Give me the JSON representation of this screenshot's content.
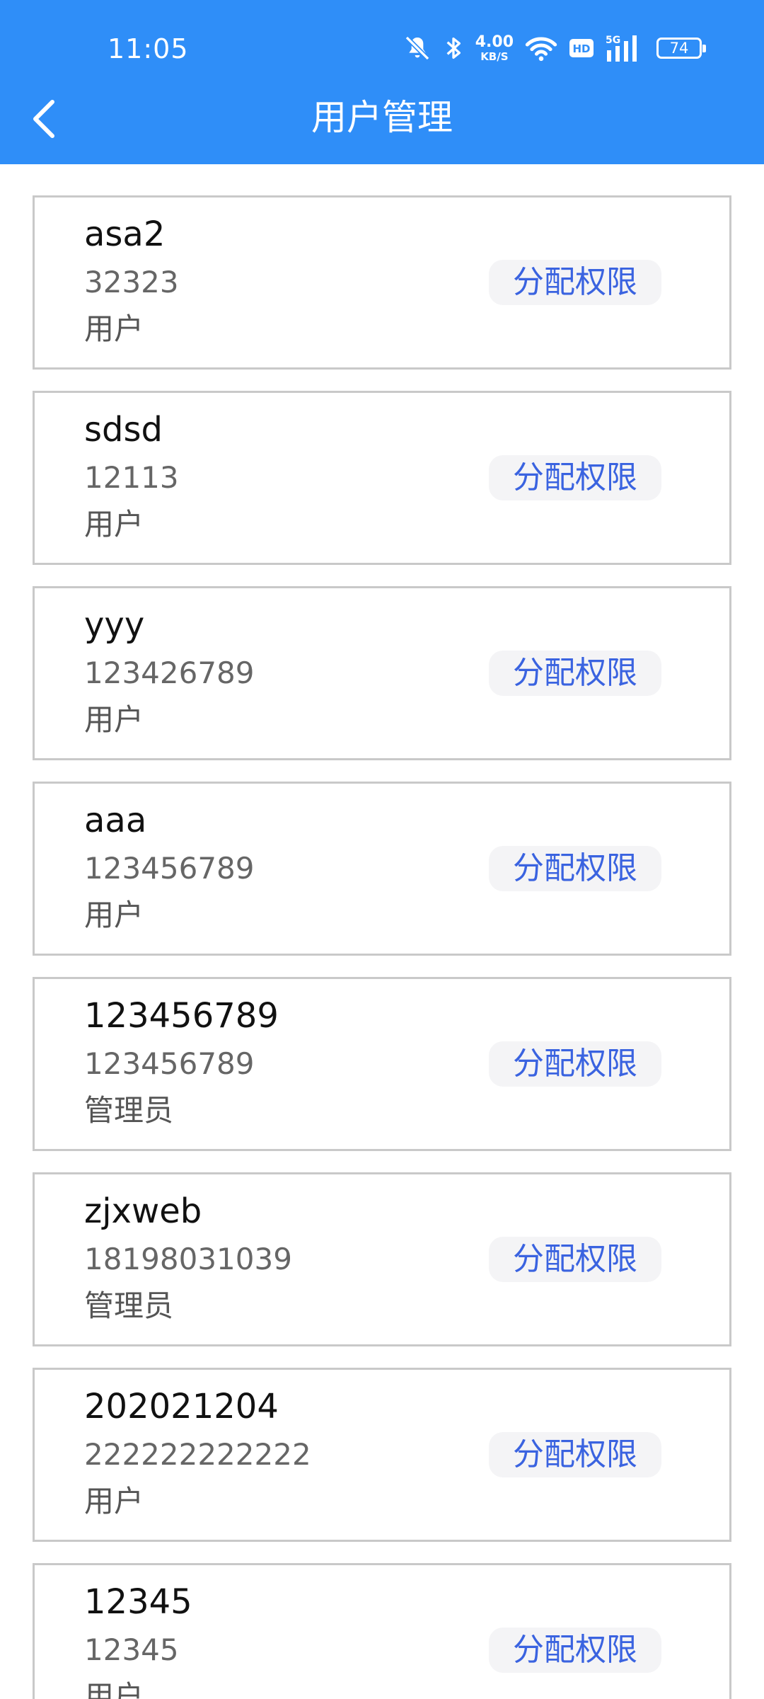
{
  "status_bar": {
    "time": "11:05",
    "speed_value": "4.00",
    "speed_unit": "KB/S",
    "network": "5G",
    "hd": "HD",
    "battery": "74",
    "icons": [
      "mute-icon",
      "bluetooth-icon",
      "wifi-icon",
      "hd-icon",
      "signal-icon",
      "battery-icon"
    ]
  },
  "header": {
    "title": "用户管理",
    "back_icon": "back-chevron-icon"
  },
  "colors": {
    "header_bg": "#2f8ef8",
    "button_text": "#3a63e0",
    "button_bg": "#f4f4f6",
    "card_border": "#c9c9c9"
  },
  "users": [
    {
      "name": "asa2",
      "phone": "32323",
      "role": "用户",
      "action": "分配权限"
    },
    {
      "name": "sdsd",
      "phone": "12113",
      "role": "用户",
      "action": "分配权限"
    },
    {
      "name": "yyy",
      "phone": "123426789",
      "role": "用户",
      "action": "分配权限"
    },
    {
      "name": "aaa",
      "phone": "123456789",
      "role": "用户",
      "action": "分配权限"
    },
    {
      "name": "123456789",
      "phone": "123456789",
      "role": "管理员",
      "action": "分配权限"
    },
    {
      "name": "zjxweb",
      "phone": "18198031039",
      "role": "管理员",
      "action": "分配权限"
    },
    {
      "name": "202021204",
      "phone": "222222222222",
      "role": "用户",
      "action": "分配权限"
    },
    {
      "name": "12345",
      "phone": "12345",
      "role": "用户",
      "action": "分配权限"
    }
  ]
}
